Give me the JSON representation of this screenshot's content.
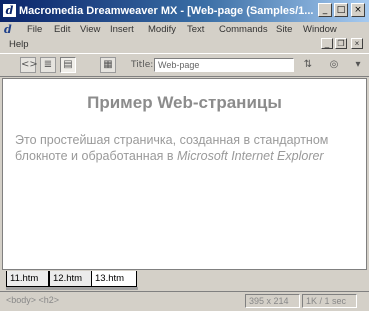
{
  "window": {
    "title": "Macromedia Dreamweaver MX - [Web-page (Samples/1..."
  },
  "menu": {
    "items": [
      "File",
      "Edit",
      "View",
      "Insert",
      "Modify",
      "Text",
      "Commands",
      "Site",
      "Window",
      "Help"
    ]
  },
  "toolbar": {
    "title_label": "Title:",
    "title_value": "Web-page"
  },
  "document": {
    "heading": "Пример Web-страницы",
    "paragraph_text": "Это простейшая страничка, созданная в стандартном блокноте и обработанная в",
    "paragraph_emphasis": "Microsoft Internet Explorer"
  },
  "tabs": [
    "11.htm",
    "12.htm",
    "13.htm"
  ],
  "active_tab": "13.htm",
  "status": {
    "tag_selector": "<body> <h2>",
    "window_size": "395 x 214",
    "download": "1K / 1 sec"
  }
}
